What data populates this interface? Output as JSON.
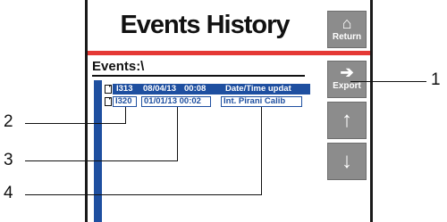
{
  "screen": {
    "title": "Events History",
    "folder_label": "Events:\\"
  },
  "events": [
    {
      "id": "I313",
      "date": "08/04/13",
      "time": "00:08",
      "description": "Date/Time updat",
      "selected": true
    },
    {
      "id": "I320",
      "date": "01/01/13",
      "time": "00:02",
      "description": "Int. Pirani Calib",
      "selected": false
    }
  ],
  "buttons": {
    "return_label": "Return",
    "export_label": "Export",
    "return_icon": "home-icon",
    "export_icon": "arrow-right-icon",
    "up_icon": "arrow-up-icon",
    "down_icon": "arrow-down-icon"
  },
  "callouts": [
    "1",
    "2",
    "3",
    "4"
  ],
  "colors": {
    "accent_red": "#e53935",
    "selection_blue": "#1e4fa0",
    "button_gray": "#8c8c8c"
  }
}
